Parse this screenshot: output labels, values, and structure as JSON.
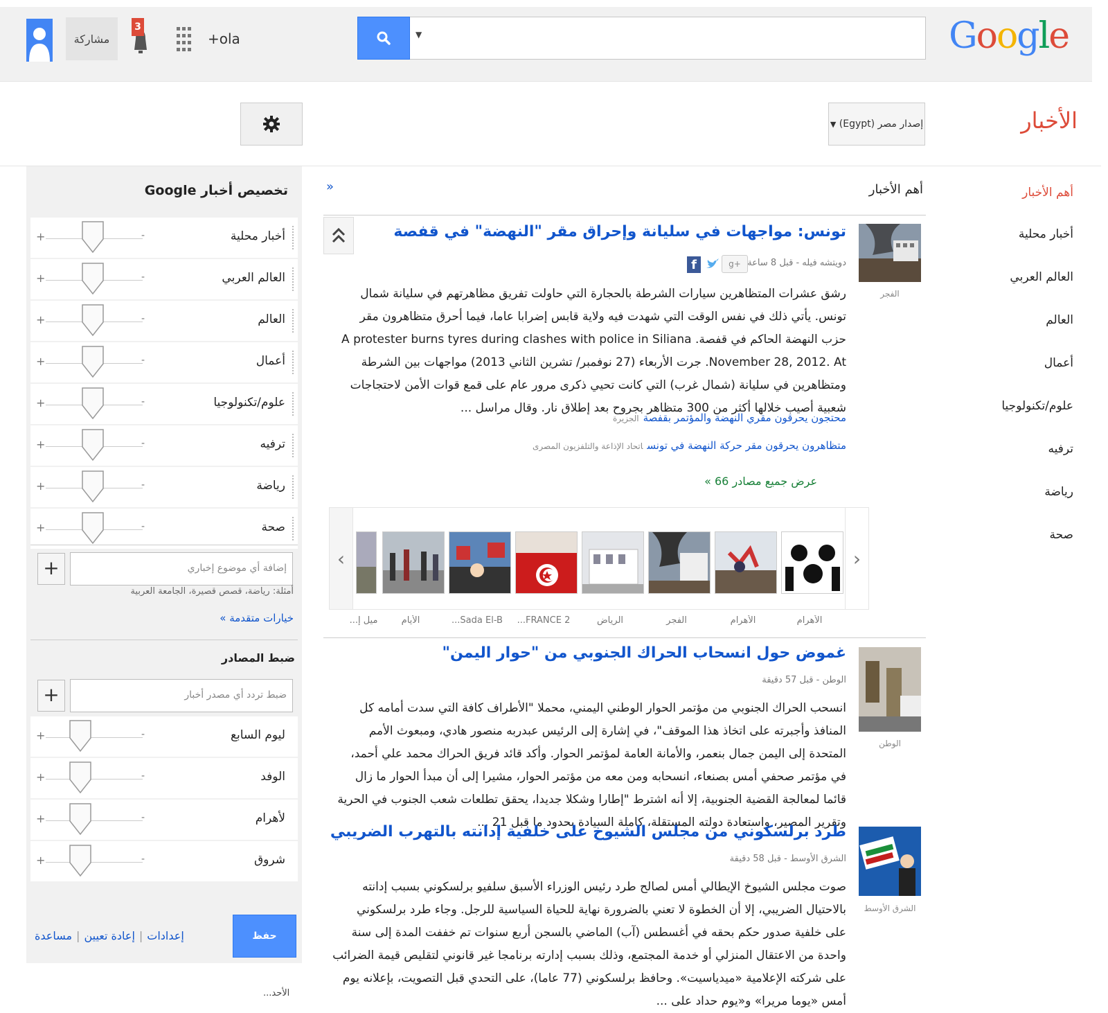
{
  "colors": {
    "accent": "#4d90fe",
    "link": "#1155cc",
    "brand_red": "#dd4b39",
    "green": "#188038"
  },
  "header": {
    "logo": "Google",
    "user_plus": "+ola",
    "notification_count": "3",
    "share_label": "مشاركة",
    "search_value": "",
    "section_title": "الأخبار",
    "edition_label": "إصدار مصر (Egypt)"
  },
  "nav": {
    "items": [
      {
        "label": "أهم الأخبار",
        "active": true
      },
      {
        "label": "أخبار محلية"
      },
      {
        "label": "العالم العربي"
      },
      {
        "label": "العالم"
      },
      {
        "label": "أعمال"
      },
      {
        "label": "علوم/تكنولوجيا"
      },
      {
        "label": "ترفيه"
      },
      {
        "label": "رياضة"
      },
      {
        "label": "صحة"
      }
    ]
  },
  "personalize": {
    "title": "تخصيص أخبار Google",
    "topics": [
      {
        "label": "أخبار محلية"
      },
      {
        "label": "العالم العربي"
      },
      {
        "label": "العالم"
      },
      {
        "label": "أعمال"
      },
      {
        "label": "علوم/تكنولوجيا"
      },
      {
        "label": "ترفيه"
      },
      {
        "label": "رياضة"
      },
      {
        "label": "صحة"
      }
    ],
    "add_topic_placeholder": "إضافة أي موضوع إخباري",
    "examples": "أمثلة: رياضة، قصص قصيرة، الجامعة العربية",
    "advanced_options": "خيارات متقدمة »",
    "sources_title": "ضبط المصادر",
    "add_source_placeholder": "ضبط تردد أي مصدر أخبار",
    "sources": [
      {
        "label": "ليوم السابع"
      },
      {
        "label": "الوفد"
      },
      {
        "label": "لأهرام"
      },
      {
        "label": "شروق"
      }
    ],
    "save_label": "حفظ",
    "links": [
      "إعدادات",
      "إعادة تعيين",
      "مساعدة"
    ],
    "bottom_cut": "الأحد..."
  },
  "main": {
    "section_title": "أهم الأخبار",
    "stories": [
      {
        "title": "تونس: مواجهات في سليانة وإحراق مقر \"النهضة\" في قفصة",
        "meta": "دويتشه فيله - قبل 8 ساعة",
        "thumb_caption": "الفجر",
        "body": "رشق عشرات المتظاهرين سيارات الشرطة بالحجارة التي حاولت تفريق مظاهرتهم في سليانة شمال تونس. يأتي ذلك في نفس الوقت التي شهدت فيه ولاية قابس إضرابا عاما، فيما أحرق متظاهرون مقر حزب النهضة الحاكم في قفصة. A protester burns tyres during clashes with police in Siliana November 28, 2012. At. جرت الأربعاء (27 نوفمبر/ تشرين الثاني 2013) مواجهات بين الشرطة ومتظاهرين في سليانة (شمال غرب) التي كانت تحيي ذكرى مرور عام على قمع قوات الأمن لاحتجاجات شعبية أصيب خلالها أكثر من 300 متظاهر بجروح بعد إطلاق نار. وقال مراسل ...",
        "related": [
          {
            "text": "محتجون يحرقون مقري النهضة والمؤتمر بقفصة",
            "source": "الجزيرة"
          },
          {
            "text": "متظاهرون يحرقون مقر حركة النهضة في تونس",
            "source": "اتحاد الإذاعة والتلفزيون المصرى"
          }
        ],
        "view_all": "عرض جميع مصادر 66 »",
        "carousel_captions": [
          "الأهرام",
          "الأهرام",
          "الفجر",
          "الرياض",
          "FRANCE 2...",
          "Sada El-B...",
          "الأيام",
          "ميل إ..."
        ]
      },
      {
        "title": "غموض حول انسحاب الحراك الجنوبي من \"حوار اليمن\"",
        "meta": "الوطن - قبل 57 دقيقة",
        "thumb_caption": "الوطن",
        "body": "انسحب الحراك الجنوبي من مؤتمر الحوار الوطني اليمني، محملا \"الأطراف كافة التي سدت أمامه كل المنافذ وأجبرته على اتخاذ هذا الموقف\"، في إشارة إلى الرئيس عبدربه منصور هادي، ومبعوث الأمم المتحدة إلى اليمن جمال بنعمر، والأمانة العامة لمؤتمر الحوار. وأكد قائد فريق الحراك محمد علي أحمد، في مؤتمر صحفي أمس بصنعاء، انسحابه ومن معه من مؤتمر الحوار، مشيرا إلى أن مبدأ الحوار ما زال قائما لمعالجة القضية الجنوبية، إلا أنه اشترط \"إطارا وشكلا جديدا، يحقق تطلعات شعب الجنوب في الحرية وتقرير المصير، واستعادة دولته المستقلة، كاملة السيادة بحدود ما قبل 21 ..."
      },
      {
        "title": "طرد برلسكوني من مجلس الشيوخ على خلفية إدانته بالتهرب الضريبي",
        "meta": "الشرق الأوسط - قبل 58 دقيقة",
        "thumb_caption": "الشرق الأوسط",
        "body": "صوت مجلس الشيوخ الإيطالي أمس لصالح طرد رئيس الوزراء الأسبق سلفيو برلسكوني بسبب إدانته بالاحتيال الضريبي، إلا أن الخطوة لا تعني بالضرورة نهاية للحياة السياسية للرجل. وجاء طرد برلسكوني على خلفية صدور حكم بحقه في أغسطس (آب) الماضي بالسجن أربع سنوات تم خففت المدة إلى سنة واحدة من الاعتقال المنزلي أو خدمة المجتمع، وذلك بسبب إدارته برنامجا غير قانوني لتقليص قيمة الضرائب على شركته الإعلامية «ميدياسيت». وحافظ برلسكوني (77 عاما)، على التحدي قبل التصويت، بإعلانه يوم أمس «يوما مريرا» و«يوم حداد على ..."
      }
    ]
  }
}
